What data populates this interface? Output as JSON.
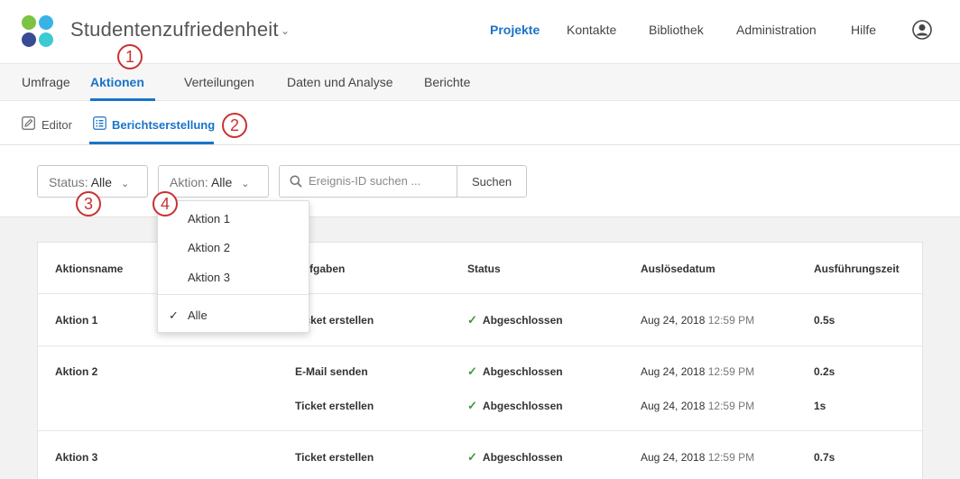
{
  "header": {
    "project_title": "Studentenzufriedenheit",
    "nav": [
      "Projekte",
      "Kontakte",
      "Bibliothek",
      "Administration",
      "Hilfe"
    ],
    "active_nav": "Projekte"
  },
  "tabs": [
    "Umfrage",
    "Aktionen",
    "Verteilungen",
    "Daten und Analyse",
    "Berichte"
  ],
  "active_tab": "Aktionen",
  "subtabs": {
    "editor": "Editor",
    "reporting": "Berichtserstellung"
  },
  "filters": {
    "status_label": "Status:",
    "status_value": "Alle",
    "action_label": "Aktion:",
    "action_value": "Alle",
    "search_placeholder": "Ereignis-ID suchen ...",
    "search_button": "Suchen"
  },
  "dropdown": {
    "items": [
      "Aktion 1",
      "Aktion 2",
      "Aktion 3"
    ],
    "selected": "Alle"
  },
  "table": {
    "headers": [
      "Aktionsname",
      "Aufgaben",
      "Status",
      "Auslösedatum",
      "Ausführungszeit"
    ],
    "rows": [
      {
        "name": "Aktion 1",
        "task": "Ticket erstellen",
        "status": "Abgeschlossen",
        "date": "Aug 24, 2018",
        "time": "12:59 PM",
        "duration": "0.5s"
      },
      {
        "name": "Aktion 2",
        "task": "E-Mail senden",
        "status": "Abgeschlossen",
        "date": "Aug 24, 2018",
        "time": "12:59 PM",
        "duration": "0.2s"
      },
      {
        "name": "",
        "task": "Ticket erstellen",
        "status": "Abgeschlossen",
        "date": "Aug 24, 2018",
        "time": "12:59 PM",
        "duration": "1s"
      },
      {
        "name": "Aktion 3",
        "task": "Ticket erstellen",
        "status": "Abgeschlossen",
        "date": "Aug 24, 2018",
        "time": "12:59 PM",
        "duration": "0.7s"
      }
    ]
  },
  "callouts": [
    "1",
    "2",
    "3",
    "4"
  ],
  "colors": {
    "accent": "#1a73c8",
    "callout": "#c83232",
    "success": "#3d9a3a"
  }
}
